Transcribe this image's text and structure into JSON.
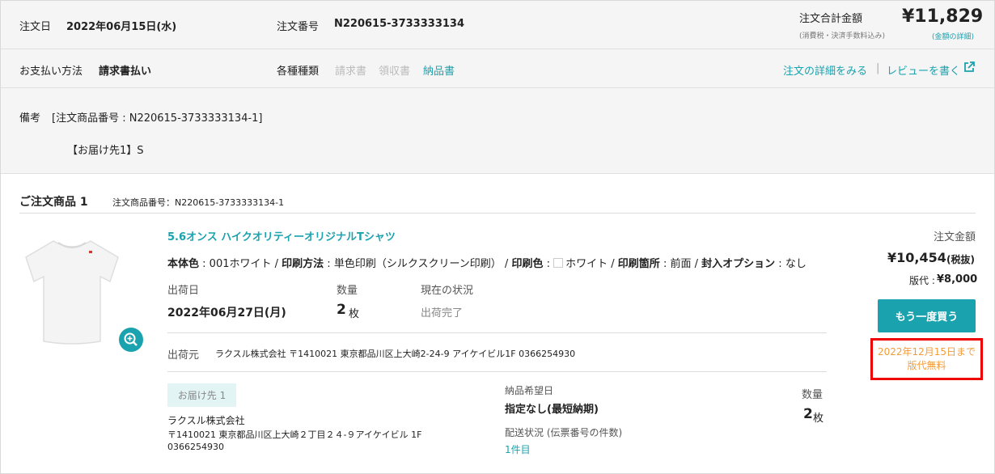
{
  "header": {
    "order_date_label": "注文日",
    "order_date": "2022年06月15日(水)",
    "order_no_label": "注文番号",
    "order_no": "N220615-3733333134",
    "total_label": "注文合計金額",
    "total_note": "(消費税・決済手数料込み)",
    "total_value": "¥11,829",
    "total_detail_link": "(金額の詳細)"
  },
  "payment": {
    "label": "お支払い方法",
    "value": "請求書払い",
    "docs_label": "各種種類",
    "docs": [
      "請求書",
      "領収書",
      "納品書"
    ],
    "detail_link": "注文の詳細をみる",
    "separator": "|",
    "review_link": "レビューを書く"
  },
  "remarks": {
    "label": "備考",
    "line1": "[注文商品番号 : N220615-3733333134-1]",
    "line2": "【お届け先1】S"
  },
  "item": {
    "heading": "ご注文商品 1",
    "item_no": "注文商品番号：N220615-3733333134-1",
    "name": "5.6オンス ハイクオリティーオリジナルTシャツ",
    "spec": {
      "body_color_label": "本体色",
      "body_color": "001ホワイト",
      "method_label": "印刷方法",
      "method": "単色印刷（シルクスクリーン印刷）",
      "print_color_label": "印刷色",
      "print_color": "ホワイト",
      "location_label": "印刷箇所",
      "location": "前面",
      "option_label": "封入オプション",
      "option": "なし",
      "sep": " / ",
      "colon": " : "
    },
    "ship_date_label": "出荷日",
    "ship_date": "2022年06月27日(月)",
    "qty_label": "数量",
    "qty": "2",
    "qty_unit": "枚",
    "status_label": "現在の状況",
    "status": "出荷完了",
    "origin_label": "出荷元",
    "origin": "ラクスル株式会社 〒1410021 東京都品川区上大崎2-24-9 アイケイビル1F 0366254930",
    "dest_tag": "お届け先 1",
    "dest_name": "ラクスル株式会社",
    "dest_addr": "〒1410021 東京都品川区上大崎２丁目２４-９アイケイビル 1F",
    "dest_tel": "0366254930",
    "wish_date_label": "納品希望日",
    "wish_date": "指定なし(最短納期)",
    "delivery_label": "配送状況 (伝票番号の件数)",
    "delivery_link": "1件目",
    "dest_qty_label": "数量",
    "dest_qty": "2",
    "dest_qty_unit": "枚"
  },
  "price": {
    "label": "注文金額",
    "value": "¥10,454",
    "tax_note": "(税抜)",
    "plate_label": "版代 : ",
    "plate_value": "¥8,000",
    "buy_again": "もう一度買う",
    "promo": "2022年12月15日まで版代無料"
  },
  "colors": {
    "accent": "#1aa2ae",
    "promo_text": "#f39c3c",
    "promo_border": "#e00000"
  }
}
